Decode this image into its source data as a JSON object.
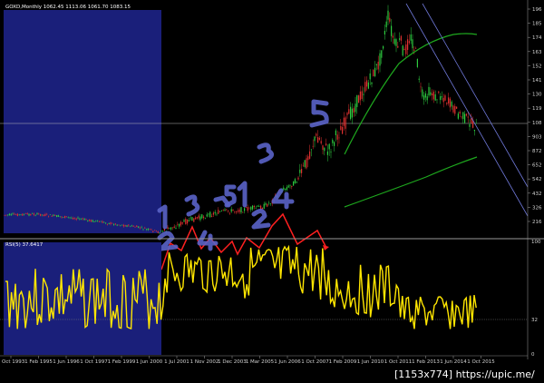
{
  "header": {
    "main_title": "GOXD,Monthly  1062.45 1113.06 1061.70 1083.15",
    "rsi_title": "RSI(5) 37.6417"
  },
  "watermark": "[1153x774] https://upic.me/",
  "colors": {
    "background": "#000000",
    "blue_box": "#1a1f7a",
    "candle_up": "#2ecc40",
    "candle_down": "#e03030",
    "sma_line": "#1ea81e",
    "rsi_line": "#ffe600",
    "red_zigzag": "#ff2020",
    "channel_line": "#6f78d8",
    "handwriting": "#5a63c8",
    "h_line": "#b8b8b8"
  },
  "chart_data": [
    {
      "type": "line",
      "title": "GOXD,Monthly",
      "price_axis_ticks": [
        "196",
        "185",
        "174",
        "163",
        "152",
        "141",
        "130",
        "119",
        "108",
        "903",
        "872",
        "652",
        "542",
        "432",
        "326",
        "216"
      ],
      "date_axis_ticks": [
        "1 Oct 1993",
        "1 Feb 1995",
        "1 Jun 1996",
        "1 Oct 1997",
        "1 Feb 1999",
        "1 Jun 2000",
        "1 Jul 2001",
        "1 Nov 2002",
        "1 Dec 2003",
        "1 Mar 2005",
        "1 Jun 2006",
        "1 Oct 2007",
        "1 Feb 2009",
        "1 Jun 2010",
        "1 Oct 2011",
        "1 Feb 2013",
        "1 Jun 2014",
        "1 Oct 2015"
      ],
      "last_price": "1083.15",
      "handwritten_labels": [
        "1",
        "2",
        "3",
        "4",
        "5",
        "1",
        "2",
        "3",
        "4",
        "5"
      ]
    },
    {
      "type": "line",
      "title": "RSI(5) 37.6417",
      "y_ticks": [
        "100",
        "32",
        "0"
      ]
    }
  ]
}
